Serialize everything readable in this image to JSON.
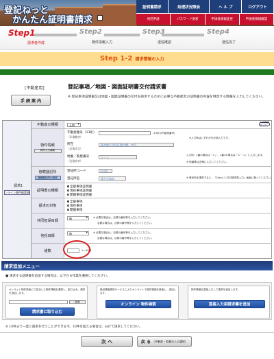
{
  "header": {
    "logo_line1": "登記ねっと",
    "logo_line2": "かんたん証明書請求",
    "nav_top": [
      "証明書請求",
      "処理状況照会",
      "ヘ ル プ",
      "ログアウト"
    ],
    "nav_bottom": [
      "供託申請",
      "パスワード更新",
      "申請者情報変更",
      "申請者情報確認"
    ]
  },
  "steps": [
    {
      "num": "Step1",
      "desc": "請求者作成"
    },
    {
      "num": "Step2",
      "desc": "物件情報入力"
    },
    {
      "num": "Step3",
      "desc": "送信確認"
    },
    {
      "num": "Step4",
      "desc": "送信完了"
    }
  ],
  "banner": {
    "step": "Step 1-2",
    "text": "請求情報の入力"
  },
  "form_head": {
    "type": "[不動産用]",
    "guide_button": "手 続 案 内",
    "title": "登記事項／地図・図面証明書交付請求書",
    "note": "※ 登記事項証明書又は地図・図面証明書の交付を請求するために必要な不動産及び証明書の内容を特定する情報を入力してください。"
  },
  "form": {
    "left_label": "請求1",
    "left_button": "オンライン物件検索結果",
    "clear_button": "入力内容クリア",
    "rows": {
      "kind": {
        "label": "不動産の種類",
        "value": "土地"
      },
      "property": {
        "label": "物件情報",
        "sub_button": "物件入力補助",
        "number_label": "不動産番号（13桁）",
        "number_note": "(13桁の不動産番号)",
        "number_hint": "（半角数字）",
        "number_right": "※入力時はいずれかを必須入力です。",
        "location_label": "所在",
        "location_hint": "（全角文字）",
        "location_value": "東京都千代田区霞が関一丁目",
        "lot_label": "地番／家屋番号",
        "lot_hint": "（全角文字）",
        "lot_value": "１－１",
        "lot_note1": "入力例：1番の場合は「１」、1番1の場合は「１－１」と入力します。",
        "lot_note2": "※ 地番等は正確に入力してください。"
      },
      "office": {
        "label": "管轄登記所",
        "sub_button": "管轄登記所の検索",
        "code_label": "登記所コード",
        "code_value": "0100",
        "name_label": "登記所名",
        "name_value": "東京法務局",
        "note": "※ 登記所を選択すると、「Step1-3 交付請求書入力」画面に移ってください。"
      },
      "cert_type": {
        "label": "証明書の種類",
        "options": [
          "全部事項証明書",
          "現在事項証明書",
          "閉鎖事項証明書"
        ]
      },
      "target": {
        "label": "請求の対象",
        "options": [
          "全部事項",
          "現在事項",
          "閉鎖事項"
        ]
      },
      "joint": {
        "label": "共同担保目録",
        "value": "無",
        "note1": "※ 必要な場合は、目録の番号等を入力してください。",
        "note2": "必要な場合は、目録の番号等を入力してください。"
      },
      "trust": {
        "label": "信託目録",
        "value": "無",
        "note1": "※ 必要な場合は、目録の番号等を入力してください。",
        "note2": "必要な場合は、目録の番号等を入力してください。"
      },
      "copies": {
        "label": "通数",
        "unit": "1〜99通",
        "value": ""
      }
    }
  },
  "add_menu": {
    "title": "請求追加メニュー",
    "note": "■ 請求する証明書を追加する場合は、以下から作業を選択してください。",
    "cards": [
      {
        "text": "オンライン物件検索にて該当した物件情報を選択し、取り込み、請求を追加します。",
        "browse": "参照",
        "button": "請求書に取り込む"
      },
      {
        "text": "登記情報提供サービスによりオンラインで物件情報を検索し、追加します。",
        "button": "オンライン 物件検索"
      },
      {
        "text": "物件情報を直接入力して請求を追加します。",
        "button": "直接入力用請求欄を追加"
      }
    ]
  },
  "bottom_note": "※ 10件まで一度に請求を行うことができます。10件を超える場合は、分けて請求してください。",
  "buttons": {
    "next": "次 へ",
    "back": "戻 る",
    "back_sub": "（不動産・商業法人の選択）"
  }
}
